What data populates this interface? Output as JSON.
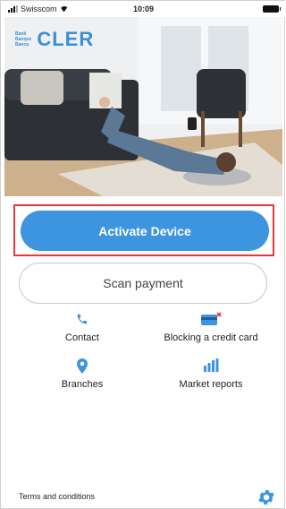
{
  "status_bar": {
    "carrier": "Swisscom",
    "time": "10:09"
  },
  "brand": {
    "small_lines": [
      "Bank",
      "Banque",
      "Banca"
    ],
    "name": "CLER",
    "color": "#3a8fd6"
  },
  "buttons": {
    "activate_label": "Activate Device",
    "scan_label": "Scan payment"
  },
  "shortcuts": [
    {
      "label": "Contact",
      "icon": "phone-icon"
    },
    {
      "label": "Blocking a credit card",
      "icon": "credit-card-block-icon"
    },
    {
      "label": "Branches",
      "icon": "location-pin-icon"
    },
    {
      "label": "Market reports",
      "icon": "bar-chart-icon"
    }
  ],
  "footer": {
    "terms_label": "Terms and conditions",
    "settings_icon": "gear-icon"
  },
  "colors": {
    "accent": "#3d95e0",
    "highlight_border": "#e53a3a"
  }
}
